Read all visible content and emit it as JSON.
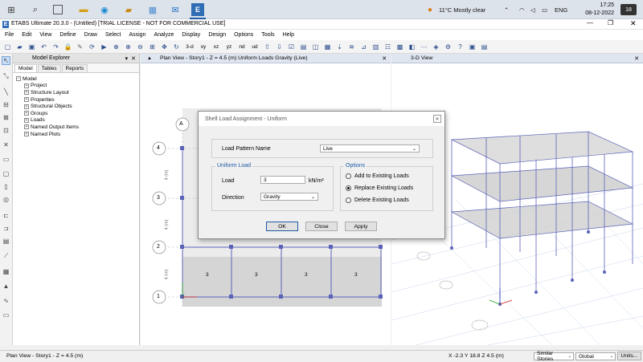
{
  "taskbar": {
    "weather": "11°C  Mostly clear",
    "language": "ENG",
    "time": "17:25",
    "date": "08-12-2022",
    "badge": "18"
  },
  "window": {
    "title": "ETABS Ultimate 20.3.0 - (Untitled)  [TRIAL LICENSE - NOT FOR COMMERCIAL USE]"
  },
  "menu": [
    "File",
    "Edit",
    "View",
    "Define",
    "Draw",
    "Select",
    "Assign",
    "Analyze",
    "Display",
    "Design",
    "Options",
    "Tools",
    "Help"
  ],
  "toolbar": {
    "label_3d": "3-d",
    "label_xy": "xy",
    "label_xz": "xz",
    "label_yz": "yz",
    "label_nd": "nd",
    "label_ud": "ud"
  },
  "explorer": {
    "title": "Model Explorer",
    "tabs": [
      "Model",
      "Tables",
      "Reports"
    ],
    "root": "Model",
    "items": [
      "Project",
      "Structure Layout",
      "Properties",
      "Structural Objects",
      "Groups",
      "Loads",
      "Named Output Items",
      "Named Plots"
    ]
  },
  "plan_view": {
    "title": "Plan View - Story1 - Z = 4.5 (m)  Uniform Loads Gravity  (Live)",
    "grid_x": [
      "A"
    ],
    "grid_y": [
      "4",
      "3",
      "2",
      "1"
    ],
    "dim_label": "4 (m)",
    "slab_values": [
      "3",
      "3",
      "3",
      "3"
    ]
  },
  "view_3d": {
    "title": "3-D View"
  },
  "dialog": {
    "title": "Shell Load Assignment - Uniform",
    "pattern_label": "Load Pattern Name",
    "pattern_value": "Live",
    "uniform_group": "Uniform Load",
    "load_label": "Load",
    "load_value": "3",
    "load_unit": "kN/m²",
    "direction_label": "Direction",
    "direction_value": "Gravity",
    "options_group": "Options",
    "options": [
      "Add to Existing Loads",
      "Replace Existing Loads",
      "Delete Existing Loads"
    ],
    "selected_option": "Replace Existing Loads",
    "ok": "OK",
    "close": "Close",
    "apply": "Apply"
  },
  "status": {
    "left": "Plan View - Story1 - Z = 4.5 (m)",
    "coords": "X -2.3  Y 18.8  Z 4.5 (m)",
    "stories": "Similar Stories",
    "coord_sys": "Global",
    "units": "Units..."
  },
  "colors": {
    "accent": "#1e5aa8",
    "frame": "#5b63b8",
    "slab": "#d5d5d5"
  }
}
